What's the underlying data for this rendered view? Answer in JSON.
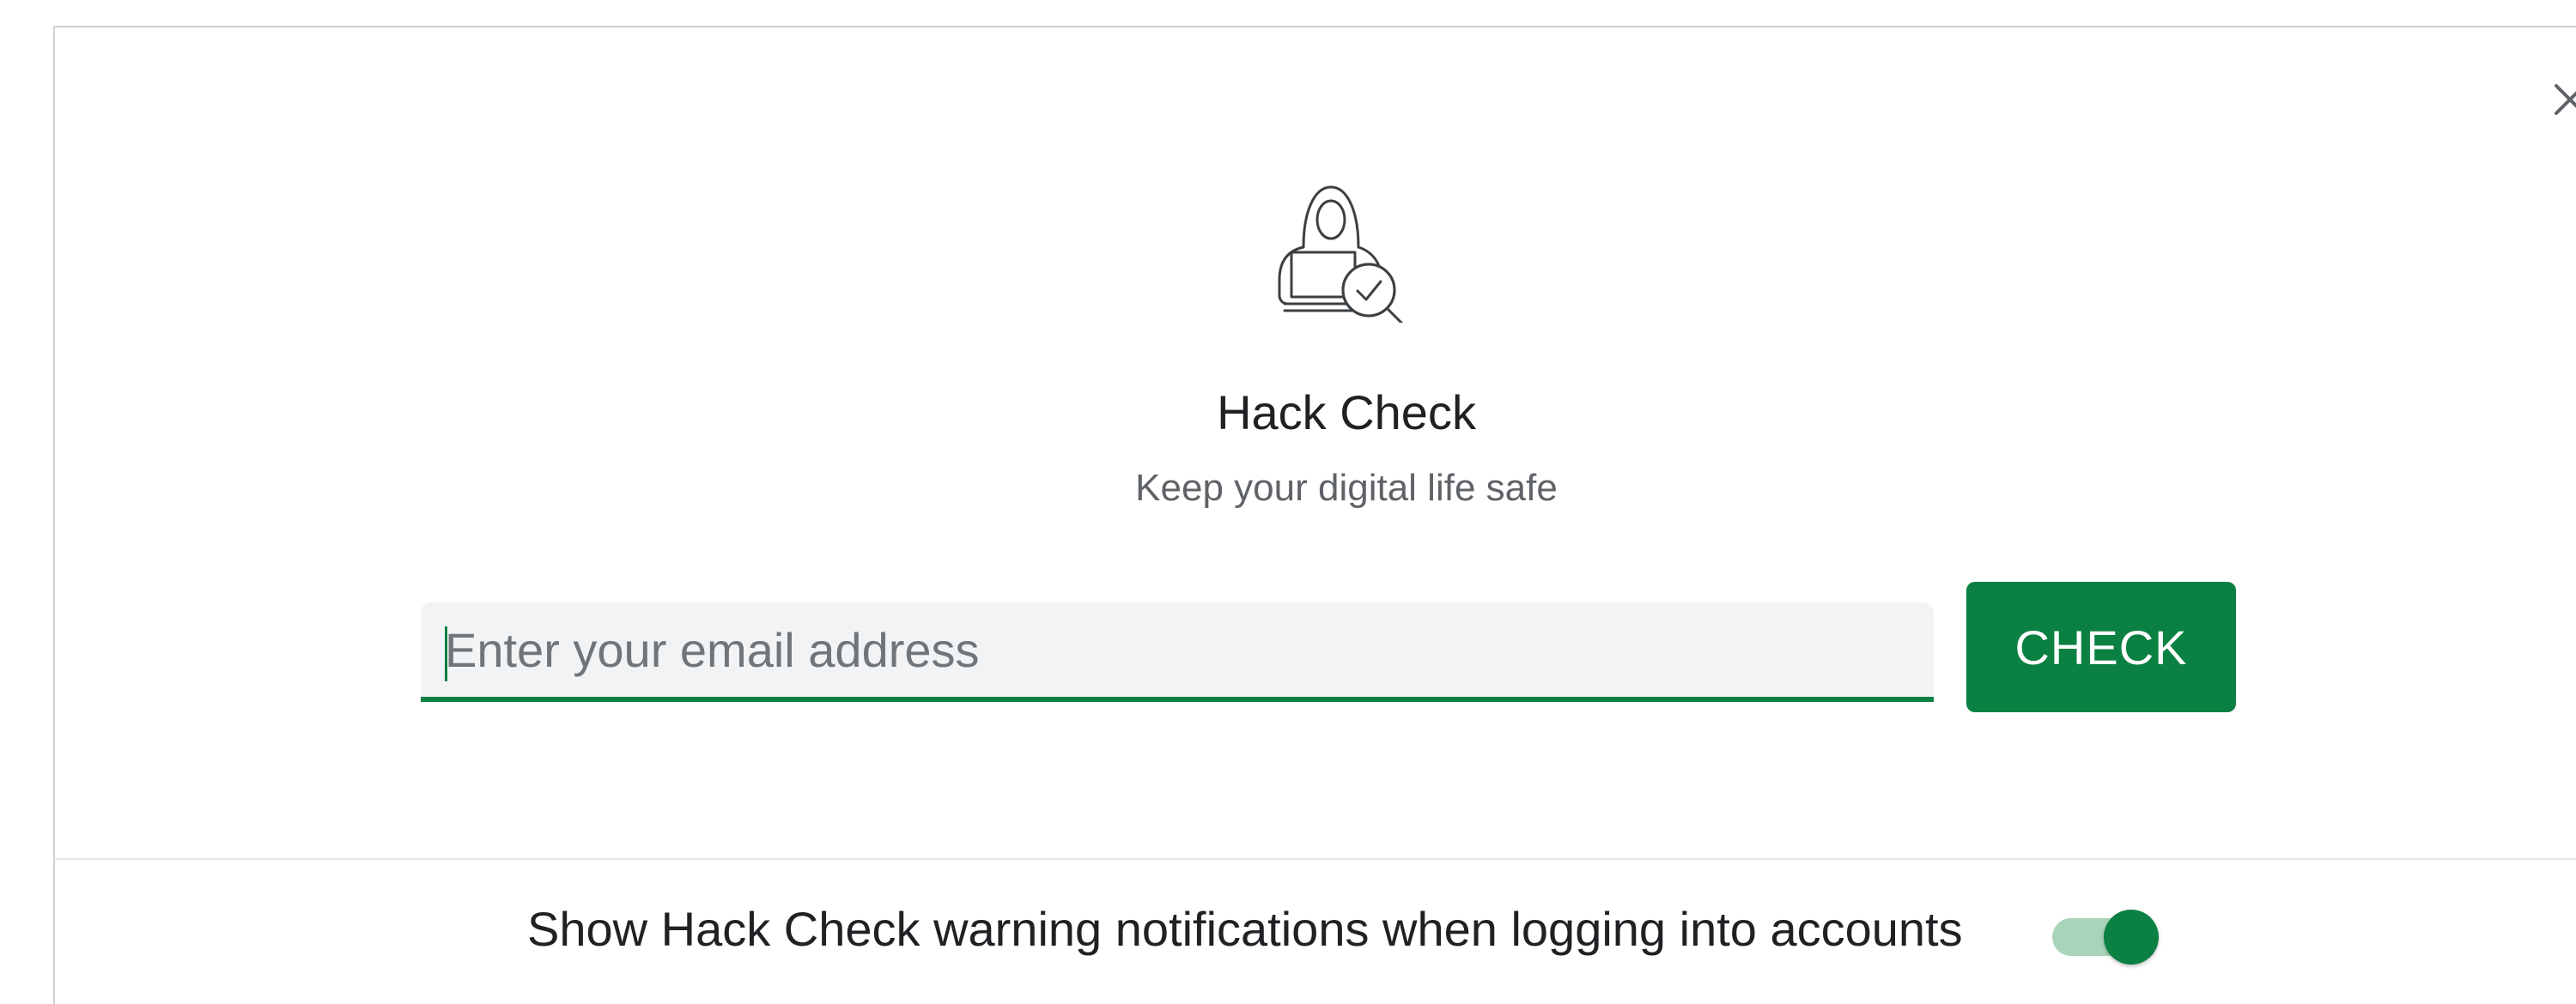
{
  "dialog": {
    "close_icon": "close-icon",
    "hero_icon": "hacker-laptop-magnifier-icon",
    "title": "Hack Check",
    "subtitle": "Keep your digital life safe"
  },
  "form": {
    "email_placeholder": "Enter your email address",
    "email_value": "",
    "check_label": "CHECK"
  },
  "footer": {
    "notifications_label": "Show Hack Check warning notifications when logging into accounts",
    "toggle_on": true
  },
  "colors": {
    "accent": "#0b8043",
    "toggle_track": "#a8d5b9",
    "field_bg": "#f1f3f4",
    "title_text": "#202124",
    "subtitle_text": "#5f6368"
  }
}
